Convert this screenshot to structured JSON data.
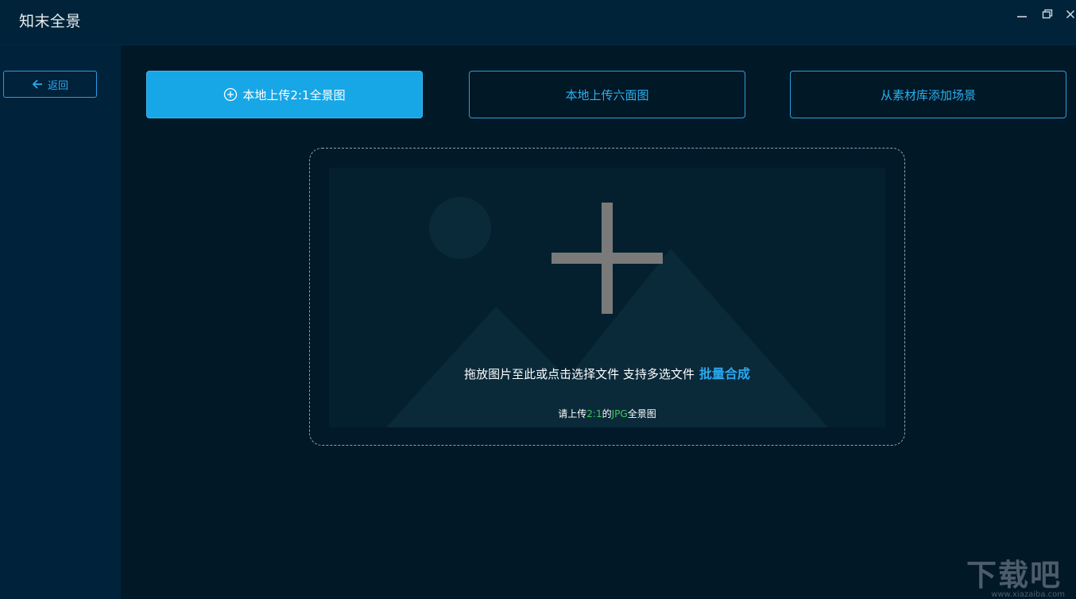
{
  "titlebar": {
    "app_title": "知末全景"
  },
  "sidebar": {
    "back_label": "返回"
  },
  "tabs": [
    {
      "label": "本地上传2:1全景图",
      "active": true
    },
    {
      "label": "本地上传六面图",
      "active": false
    },
    {
      "label": "从素材库添加场景",
      "active": false
    }
  ],
  "dropzone": {
    "instruction": "拖放图片至此或点击选择文件 支持多选文件",
    "batch_link": "批量合成",
    "hint_prefix": "请上传",
    "hint_ratio": "2:1",
    "hint_mid": "的",
    "hint_format": "JPG",
    "hint_suffix": "全景图"
  },
  "watermark": {
    "text": "下载吧",
    "url": "www.xiazaiba.com"
  },
  "colors": {
    "accent": "#17a6e6",
    "link": "#2aa9f0",
    "highlight": "#3ecb5a",
    "background": "#011827",
    "sidebar": "#00223a"
  }
}
